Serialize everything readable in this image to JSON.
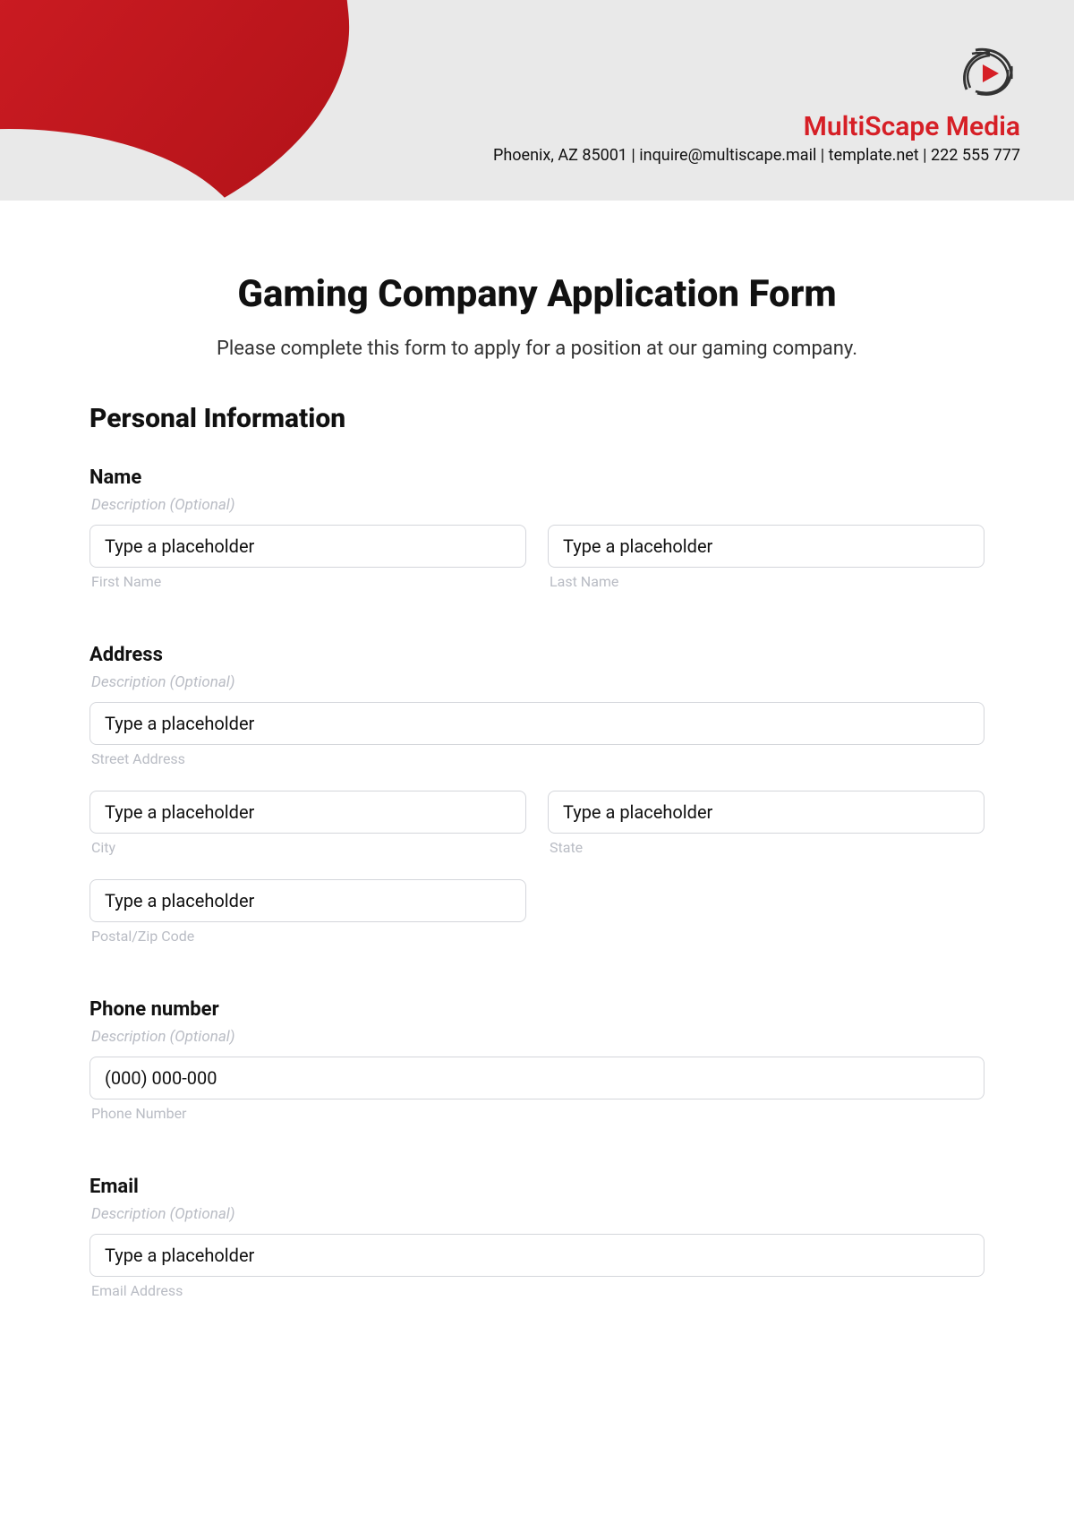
{
  "brand": {
    "name": "MultiScape Media",
    "contact": "Phoenix, AZ 85001 | inquire@multiscape.mail | template.net | 222 555 777"
  },
  "title": "Gaming Company Application Form",
  "subtitle": "Please complete this form to apply for a position at our gaming company.",
  "section_heading": "Personal Information",
  "fields": {
    "name": {
      "label": "Name",
      "desc": "Description (Optional)",
      "first_ph": "Type a placeholder",
      "first_sub": "First Name",
      "last_ph": "Type a placeholder",
      "last_sub": "Last Name"
    },
    "address": {
      "label": "Address",
      "desc": "Description (Optional)",
      "street_ph": "Type a placeholder",
      "street_sub": "Street Address",
      "city_ph": "Type a placeholder",
      "city_sub": "City",
      "state_ph": "Type a placeholder",
      "state_sub": "State",
      "zip_ph": "Type a placeholder",
      "zip_sub": "Postal/Zip Code"
    },
    "phone": {
      "label": "Phone number",
      "desc": "Description (Optional)",
      "ph": "(000) 000-000",
      "sub": "Phone Number"
    },
    "email": {
      "label": "Email",
      "desc": "Description (Optional)",
      "ph": "Type a placeholder",
      "sub": "Email Address"
    }
  }
}
